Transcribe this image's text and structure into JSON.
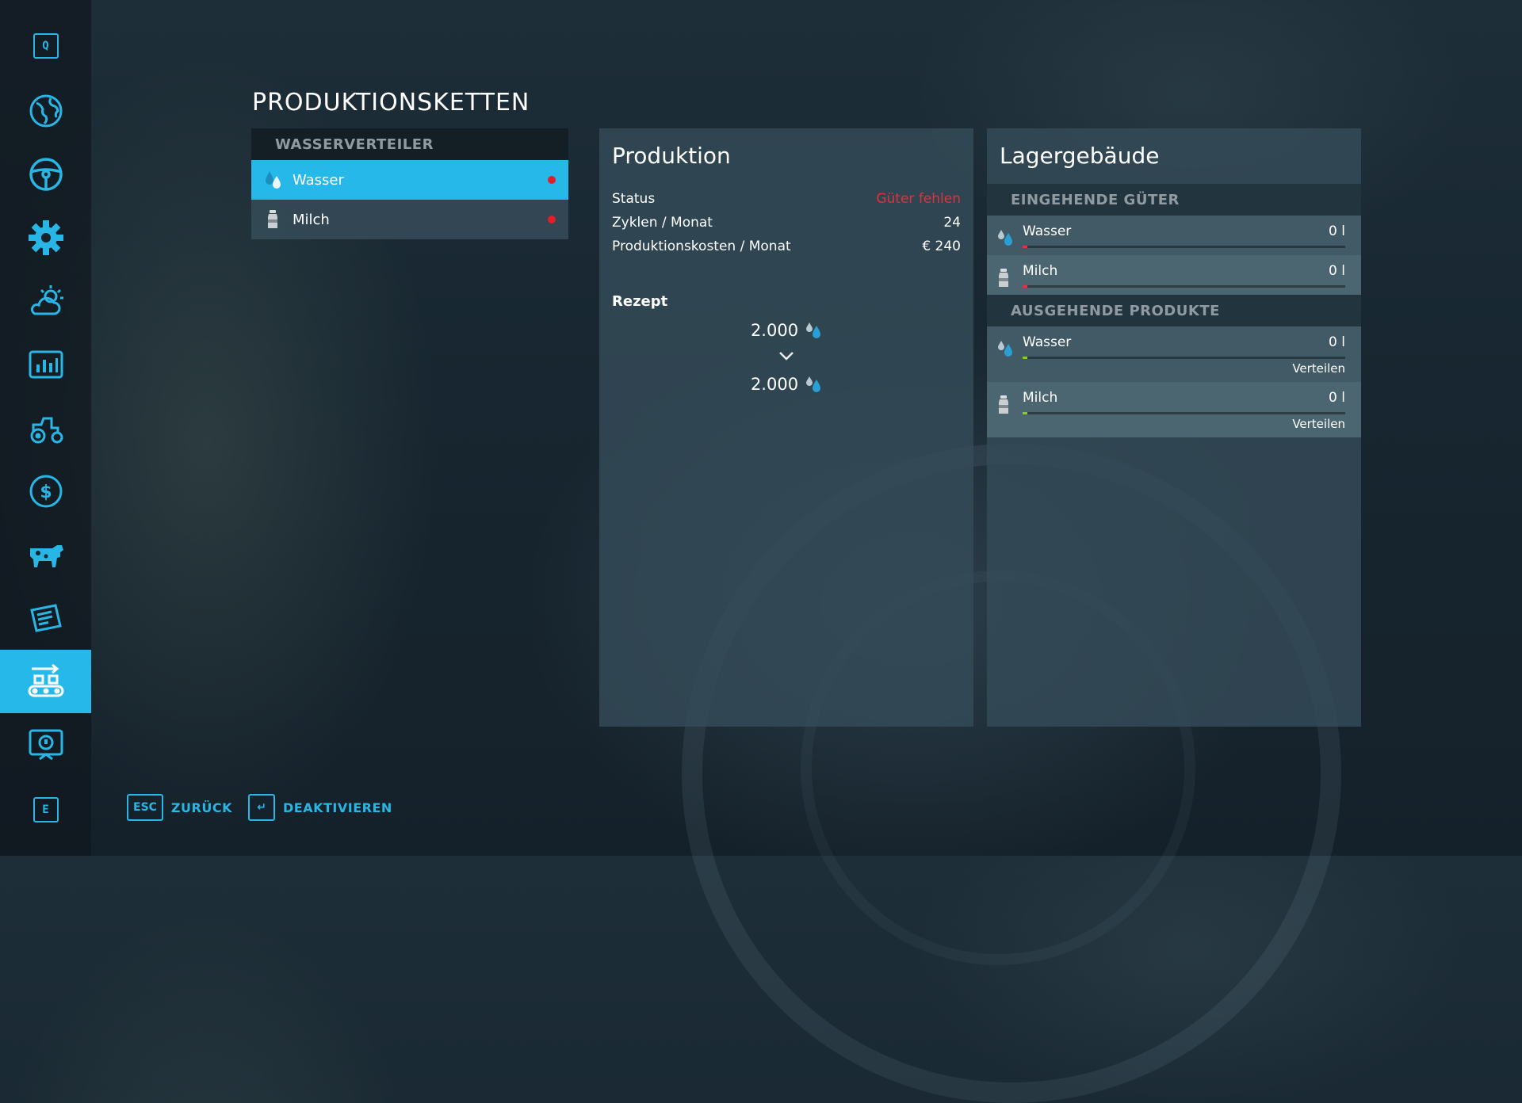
{
  "sidebar": {
    "top_key": "Q",
    "bottom_key": "E",
    "items": [
      {
        "icon": "globe-map-icon"
      },
      {
        "icon": "steering-wheel-icon"
      },
      {
        "icon": "settings-gear-icon"
      },
      {
        "icon": "weather-icon"
      },
      {
        "icon": "statistics-chart-icon"
      },
      {
        "icon": "tractor-icon"
      },
      {
        "icon": "finance-dollar-icon"
      },
      {
        "icon": "animals-cow-icon"
      },
      {
        "icon": "contracts-icon"
      },
      {
        "icon": "production-chains-icon"
      },
      {
        "icon": "help-icon"
      }
    ],
    "active_index": 9
  },
  "page": {
    "title": "PRODUKTIONSKETTEN"
  },
  "chain_list": {
    "header": "WASSERVERTEILER",
    "items": [
      {
        "label": "Wasser",
        "icon": "water-drop-icon",
        "selected": true,
        "status_color": "#e41d2a"
      },
      {
        "label": "Milch",
        "icon": "milk-can-icon",
        "selected": false,
        "status_color": "#e41d2a"
      }
    ]
  },
  "production": {
    "title": "Produktion",
    "status_label": "Status",
    "status_value": "Güter fehlen",
    "cycles_label": "Zyklen / Monat",
    "cycles_value": "24",
    "cost_label": "Produktionskosten / Monat",
    "cost_value": "€ 240",
    "recipe_label": "Rezept",
    "recipe_input": "2.000",
    "recipe_output": "2.000"
  },
  "storage": {
    "title": "Lagergebäude",
    "incoming_header": "EINGEHENDE GÜTER",
    "incoming": [
      {
        "name": "Wasser",
        "amount": "0 l",
        "icon": "water-drop-icon",
        "fill_color": "#e0343c"
      },
      {
        "name": "Milch",
        "amount": "0 l",
        "icon": "milk-can-icon",
        "fill_color": "#e0343c"
      }
    ],
    "outgoing_header": "AUSGEHENDE PRODUKTE",
    "outgoing": [
      {
        "name": "Wasser",
        "amount": "0 l",
        "icon": "water-drop-icon",
        "action": "Verteilen",
        "fill_color": "#8cc63f"
      },
      {
        "name": "Milch",
        "amount": "0 l",
        "icon": "milk-can-icon",
        "action": "Verteilen",
        "fill_color": "#8cc63f"
      }
    ]
  },
  "bottom_bar": {
    "back_key": "ESC",
    "back_label": "ZURÜCK",
    "deactivate_key": "↵",
    "deactivate_label": "DEAKTIVIEREN"
  },
  "colors": {
    "accent": "#27b8ea",
    "status_red": "#e2313b",
    "fill_green": "#8cc63f"
  }
}
